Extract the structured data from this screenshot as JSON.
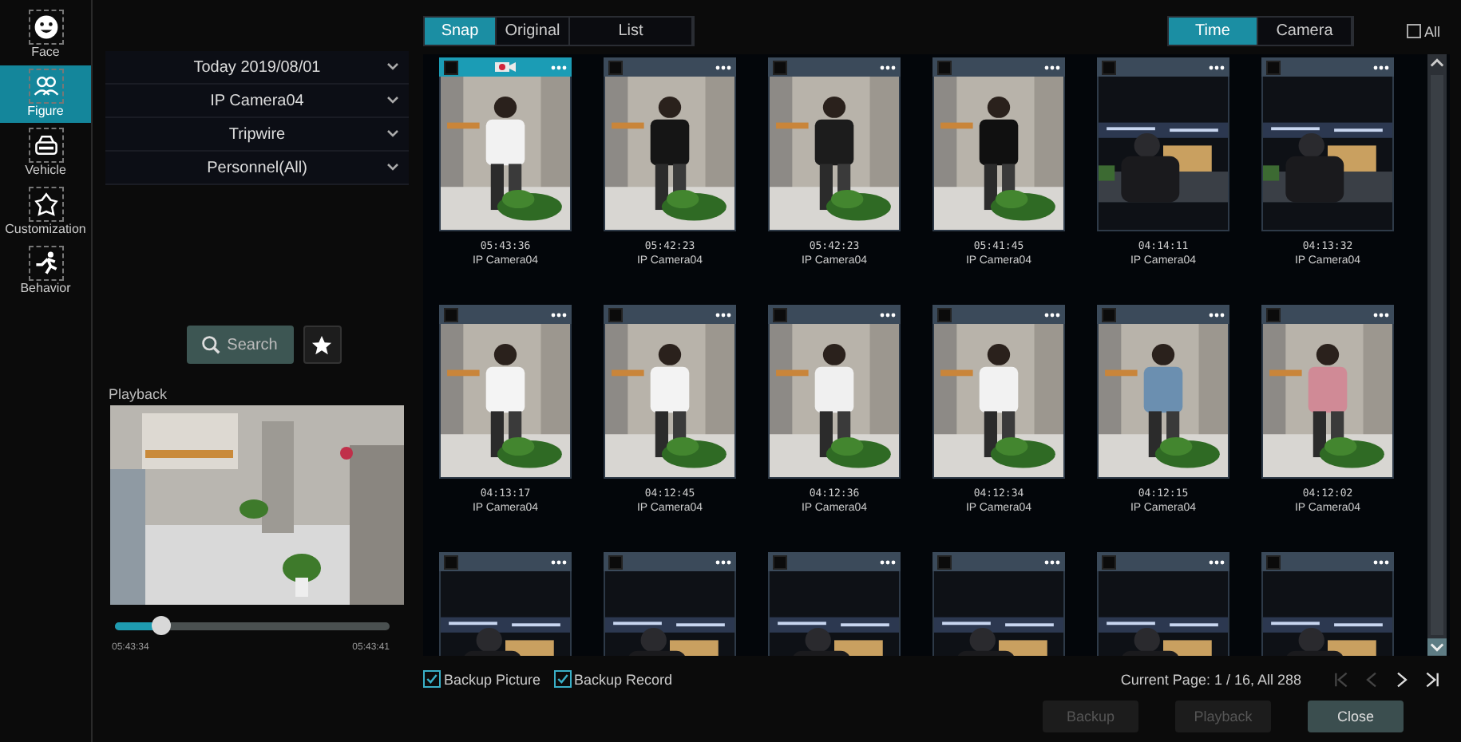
{
  "nav": [
    {
      "label": "Face",
      "selected": false
    },
    {
      "label": "Figure",
      "selected": true
    },
    {
      "label": "Vehicle",
      "selected": false
    },
    {
      "label": "Customization",
      "selected": false
    },
    {
      "label": "Behavior",
      "selected": false
    }
  ],
  "filters": [
    {
      "value": "Today 2019/08/01"
    },
    {
      "value": "IP Camera04"
    },
    {
      "value": "Tripwire"
    },
    {
      "value": "Personnel(All)"
    }
  ],
  "search_button": "Search",
  "playback": {
    "label": "Playback",
    "level": 0.17,
    "start": "05:43:34",
    "end": "05:43:41"
  },
  "view_tabs": [
    {
      "label": "Snap",
      "selected": true
    },
    {
      "label": "Original",
      "selected": false
    },
    {
      "label": "List",
      "selected": false
    }
  ],
  "sort_tabs": [
    {
      "label": "Time",
      "selected": true
    },
    {
      "label": "Camera",
      "selected": false
    }
  ],
  "select_all": {
    "label": "All",
    "checked": false
  },
  "snaps": [
    {
      "time": "05:43:36",
      "camera": "IP Camera04",
      "selected": true,
      "checked": false,
      "video_icon": true
    },
    {
      "time": "05:42:23",
      "camera": "IP Camera04",
      "selected": false,
      "checked": false,
      "video_icon": false
    },
    {
      "time": "05:42:23",
      "camera": "IP Camera04",
      "selected": false,
      "checked": false,
      "video_icon": false
    },
    {
      "time": "05:41:45",
      "camera": "IP Camera04",
      "selected": false,
      "checked": false,
      "video_icon": false
    },
    {
      "time": "04:14:11",
      "camera": "IP Camera04",
      "selected": false,
      "checked": false,
      "video_icon": false
    },
    {
      "time": "04:13:32",
      "camera": "IP Camera04",
      "selected": false,
      "checked": false,
      "video_icon": false
    },
    {
      "time": "04:13:17",
      "camera": "IP Camera04",
      "selected": false,
      "checked": false,
      "video_icon": false
    },
    {
      "time": "04:12:45",
      "camera": "IP Camera04",
      "selected": false,
      "checked": false,
      "video_icon": false
    },
    {
      "time": "04:12:36",
      "camera": "IP Camera04",
      "selected": false,
      "checked": false,
      "video_icon": false
    },
    {
      "time": "04:12:34",
      "camera": "IP Camera04",
      "selected": false,
      "checked": false,
      "video_icon": false
    },
    {
      "time": "04:12:15",
      "camera": "IP Camera04",
      "selected": false,
      "checked": false,
      "video_icon": false
    },
    {
      "time": "04:12:02",
      "camera": "IP Camera04",
      "selected": false,
      "checked": false,
      "video_icon": false
    },
    {
      "selected": false,
      "checked": false,
      "video_icon": false
    },
    {
      "selected": false,
      "checked": false,
      "video_icon": false
    },
    {
      "selected": false,
      "checked": false,
      "video_icon": false
    },
    {
      "selected": false,
      "checked": false,
      "video_icon": false
    },
    {
      "selected": false,
      "checked": false,
      "video_icon": false
    },
    {
      "selected": false,
      "checked": false,
      "video_icon": false
    }
  ],
  "backup_options": [
    {
      "label": "Backup Picture",
      "checked": true
    },
    {
      "label": "Backup Record",
      "checked": true
    }
  ],
  "page_info": "Current Page: 1 / 16, All 288",
  "pager": [
    {
      "kind": "first",
      "disabled": true
    },
    {
      "kind": "prev",
      "disabled": true
    },
    {
      "kind": "next",
      "disabled": false
    },
    {
      "kind": "last",
      "disabled": false
    }
  ],
  "buttons": [
    {
      "label": "Backup",
      "disabled": true
    },
    {
      "label": "Playback",
      "disabled": true
    },
    {
      "label": "Close",
      "disabled": false
    }
  ]
}
